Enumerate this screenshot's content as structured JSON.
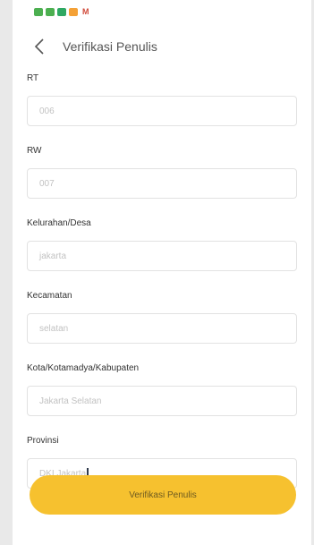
{
  "status_bar": {
    "icons": [
      {
        "name": "whatsapp-icon",
        "color": "#4caf50"
      },
      {
        "name": "whatsapp-icon",
        "color": "#4caf50"
      },
      {
        "name": "chat-icon",
        "color": "#2ea862"
      },
      {
        "name": "shop-icon",
        "color": "#f4a136"
      }
    ],
    "gmail_label": "M"
  },
  "header": {
    "title": "Verifikasi Penulis"
  },
  "form": {
    "fields": [
      {
        "label": "RT",
        "value": "006"
      },
      {
        "label": "RW",
        "value": "007"
      },
      {
        "label": "Kelurahan/Desa",
        "value": "jakarta"
      },
      {
        "label": "Kecamatan",
        "value": "selatan"
      },
      {
        "label": "Kota/Kotamadya/Kabupaten",
        "value": "Jakarta Selatan"
      },
      {
        "label": "Provinsi",
        "value": "DKI Jakarta"
      }
    ],
    "submit_label": "Verifikasi Penulis"
  },
  "colors": {
    "accent": "#f6c12f",
    "input_border": "#e2e2e2",
    "placeholder_text": "#c2c2c2"
  }
}
